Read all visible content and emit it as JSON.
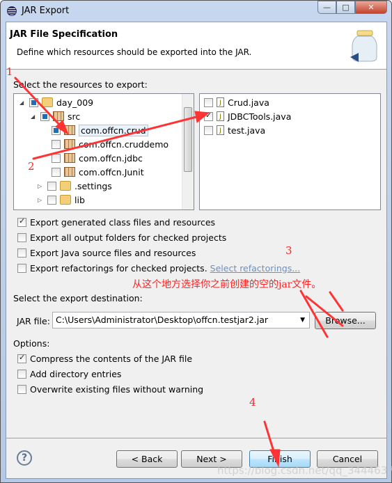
{
  "window": {
    "title": "JAR Export",
    "minimize": "—",
    "maximize": "□",
    "close": "✕"
  },
  "header": {
    "title": "JAR File Specification",
    "description": "Define which resources should be exported into the JAR."
  },
  "resources": {
    "label": "Select the resources to export:",
    "tree": [
      {
        "label": "day_009",
        "state": "partial",
        "expanded": true,
        "icon": "project-icon"
      },
      {
        "label": "src",
        "state": "partial",
        "expanded": true,
        "icon": "source-folder-icon"
      },
      {
        "label": "com.offcn.crud",
        "state": "partial",
        "icon": "package-warning-icon",
        "selected": true
      },
      {
        "label": "com.offcn.cruddemo",
        "state": "unchecked",
        "icon": "package-warning-icon"
      },
      {
        "label": "com.offcn.jdbc",
        "state": "unchecked",
        "icon": "package-warning-icon"
      },
      {
        "label": "com.offcn.Junit",
        "state": "unchecked",
        "icon": "package-icon"
      },
      {
        "label": ".settings",
        "state": "unchecked",
        "icon": "folder-icon"
      },
      {
        "label": "lib",
        "state": "unchecked",
        "icon": "folder-icon"
      }
    ],
    "files": [
      {
        "label": "Crud.java",
        "checked": false
      },
      {
        "label": "JDBCTools.java",
        "checked": true
      },
      {
        "label": "test.java",
        "checked": false
      }
    ]
  },
  "export_options": [
    {
      "label": "Export generated class files and resources",
      "checked": true
    },
    {
      "label": "Export all output folders for checked projects",
      "checked": false
    },
    {
      "label": "Export Java source files and resources",
      "checked": false
    },
    {
      "label": "Export refactorings for checked projects.",
      "checked": false
    }
  ],
  "select_refactorings_link": "Select refactorings...",
  "destination": {
    "label": "Select the export destination:",
    "jar_label": "JAR file:",
    "jar_value": "C:\\Users\\Administrator\\Desktop\\offcn.testjar2.jar",
    "browse": "Browse..."
  },
  "options": {
    "label": "Options:",
    "items": [
      {
        "label": "Compress the contents of the JAR file",
        "checked": true
      },
      {
        "label": "Add directory entries",
        "checked": false
      },
      {
        "label": "Overwrite existing files without warning",
        "checked": false
      }
    ]
  },
  "buttons": {
    "help": "?",
    "back": "< Back",
    "next": "Next >",
    "finish": "Finish",
    "cancel": "Cancel"
  },
  "annotations": {
    "n1": "1",
    "n2": "2",
    "n3": "3",
    "n4": "4",
    "note": "从这个地方选择你之前创建的空的jar文件。",
    "color": "#ff2a2a"
  },
  "watermark": "https://blog.csdn.net/qq_34446379"
}
